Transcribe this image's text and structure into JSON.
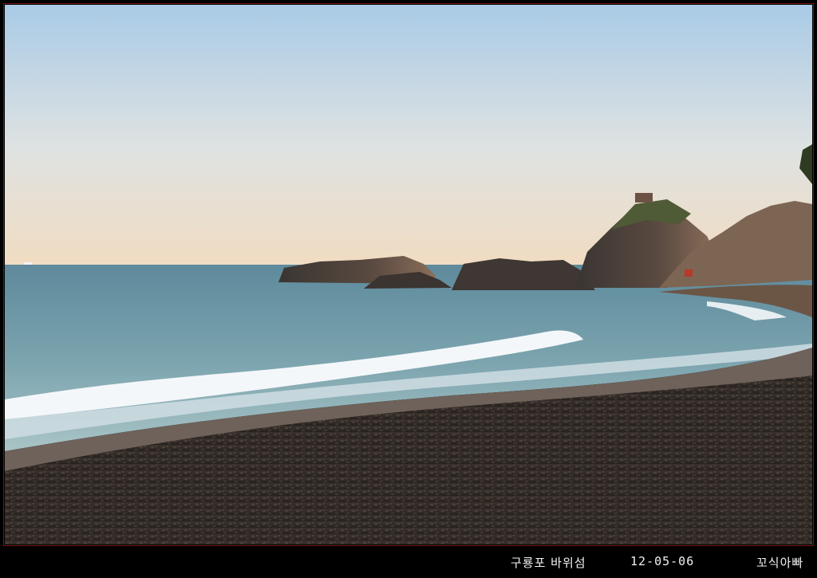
{
  "photo": {
    "description_colors": {
      "sky_top": "#a9cbe6",
      "sky_horizon": "#f1dcc0",
      "sea": "#6f98a6",
      "foam": "#f4f7fa",
      "pebbles": "#2f2a27",
      "rock": "#7a6556"
    }
  },
  "caption": {
    "location": "구룡포 바위섬",
    "date": "12-05-06",
    "author": "꼬식아빠"
  }
}
